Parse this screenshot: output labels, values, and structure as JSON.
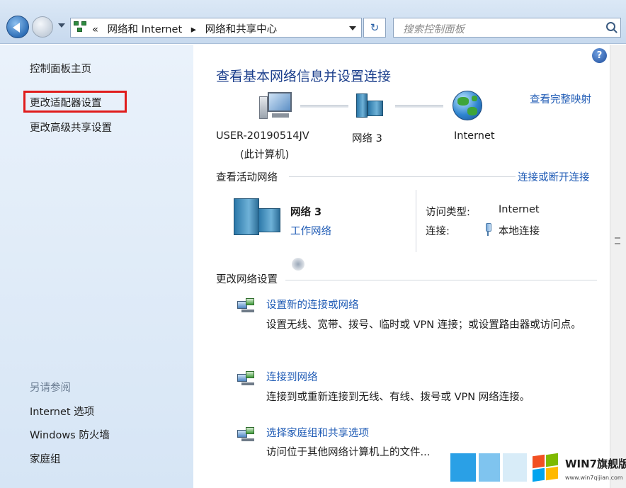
{
  "address_bar": {
    "breadcrumbs": [
      "«",
      "网络和 Internet",
      "▸",
      "网络和共享中心"
    ],
    "search_placeholder": "搜索控制面板"
  },
  "sidebar": {
    "items": [
      {
        "label": "控制面板主页"
      },
      {
        "label": "更改适配器设置",
        "highlighted": true
      },
      {
        "label": "更改高级共享设置"
      }
    ],
    "see_also_header": "另请参阅",
    "see_also": [
      "Internet 选项",
      "Windows 防火墙",
      "家庭组"
    ],
    "highlight_color": "#e01c1c"
  },
  "main": {
    "title": "查看基本网络信息并设置连接",
    "full_map_link": "查看完整映射",
    "map_nodes": [
      {
        "label": "USER-20190514JV",
        "sub": "(此计算机)",
        "icon": "computer-icon"
      },
      {
        "label": "网络  3",
        "icon": "network-icon"
      },
      {
        "label": "Internet",
        "icon": "globe-icon"
      }
    ],
    "active_header": "查看活动网络",
    "connect_link": "连接或断开连接",
    "active_network": {
      "name": "网络  3",
      "type": "工作网络",
      "access_label": "访问类型:",
      "access_value": "Internet",
      "conn_label": "连接:",
      "conn_value": "本地连接"
    },
    "change_header": "更改网络设置",
    "tasks": [
      {
        "link": "设置新的连接或网络",
        "desc": "设置无线、宽带、拨号、临时或 VPN 连接；或设置路由器或访问点。"
      },
      {
        "link": "连接到网络",
        "desc": "连接到或重新连接到无线、有线、拨号或 VPN 网络连接。"
      },
      {
        "link": "选择家庭组和共享选项",
        "desc": "访问位于其他网络计算机上的文件..."
      }
    ]
  },
  "watermark": {
    "title": "WIN7旗舰版",
    "url": "www.win7qijian.com"
  },
  "colors": {
    "link": "#1f5bb5",
    "title": "#1c3f8c",
    "sidebar_bg": "#dfeaf7"
  }
}
